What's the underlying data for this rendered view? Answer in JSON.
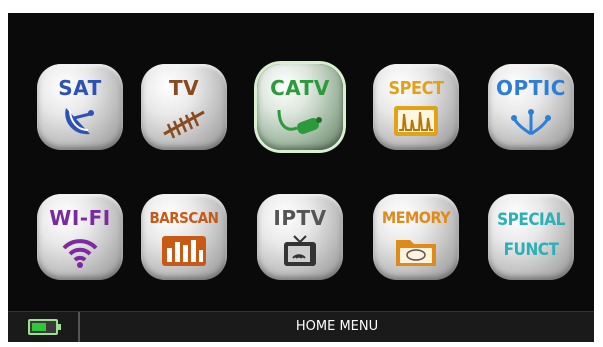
{
  "menu": {
    "tiles": [
      {
        "label": "SAT",
        "icon": "satellite-dish-icon",
        "color": "#2c52b8"
      },
      {
        "label": "TV",
        "icon": "tv-antenna-icon",
        "color": "#8a4a1f"
      },
      {
        "label": "CATV",
        "icon": "coax-cable-icon",
        "color": "#2a9a3a"
      },
      {
        "label": "SPECT",
        "icon": "spectrum-icon",
        "color": "#e1a21a"
      },
      {
        "label": "OPTIC",
        "icon": "optical-fiber-icon",
        "color": "#2c7fd8"
      },
      {
        "label": "WI-FI",
        "icon": "wifi-icon",
        "color": "#7b2aa0"
      },
      {
        "label": "BARSCAN",
        "icon": "barscan-icon",
        "color": "#c85a18"
      },
      {
        "label": "IPTV",
        "icon": "iptv-icon",
        "color": "#555555"
      },
      {
        "label": "MEMORY",
        "icon": "memory-folder-icon",
        "color": "#e08a1a"
      },
      {
        "label": "SPECIAL",
        "label2": "FUNCT",
        "icon": "special-functions-icon",
        "color": "#2ab0b8"
      }
    ]
  },
  "status_bar": {
    "title": "HOME MENU",
    "battery_icon": "battery-icon",
    "battery_level": 0.6
  }
}
